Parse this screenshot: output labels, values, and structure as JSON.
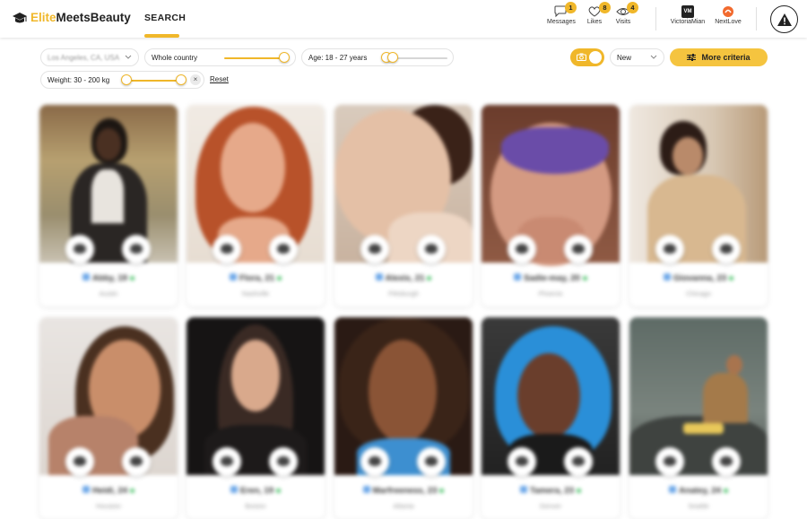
{
  "header": {
    "brand_part1": "Elite",
    "brand_part2": "MeetsBeauty",
    "nav_search": "SEARCH",
    "messages": {
      "label": "Messages",
      "count": "1",
      "icon": "chat-bubble-icon"
    },
    "likes": {
      "label": "Likes",
      "count": "8",
      "icon": "heart-icon"
    },
    "visits": {
      "label": "Visits",
      "count": "4",
      "icon": "eye-icon"
    },
    "account1": {
      "label": "VictoriaMian",
      "avatar_text": "VM"
    },
    "account2": {
      "label": "NextLove"
    },
    "alert_icon": "warning-icon"
  },
  "filters": {
    "location": "Los Angeles, CA, USA",
    "distance": "Whole country",
    "age": "Age: 18 - 27 years",
    "weight": "Weight: 30 - 200 kg",
    "reset": "Reset",
    "sort": "New",
    "more_criteria": "More criteria",
    "accent": "#f0b72a"
  },
  "profiles": [
    {
      "name": "Abby, 19",
      "city": "Austin"
    },
    {
      "name": "Flora, 21",
      "city": "Nashville"
    },
    {
      "name": "Alexis, 21",
      "city": "Pittsburgh"
    },
    {
      "name": "Sadie-may, 20",
      "city": "Phoenix"
    },
    {
      "name": "Giovanna, 23",
      "city": "Chicago"
    },
    {
      "name": "Heidi, 24",
      "city": "Houston"
    },
    {
      "name": "Eren, 19",
      "city": "Boston"
    },
    {
      "name": "Marfreeness, 23",
      "city": "Atlanta"
    },
    {
      "name": "Tamera, 23",
      "city": "Denver"
    },
    {
      "name": "Anatey, 24",
      "city": "Seattle"
    }
  ]
}
